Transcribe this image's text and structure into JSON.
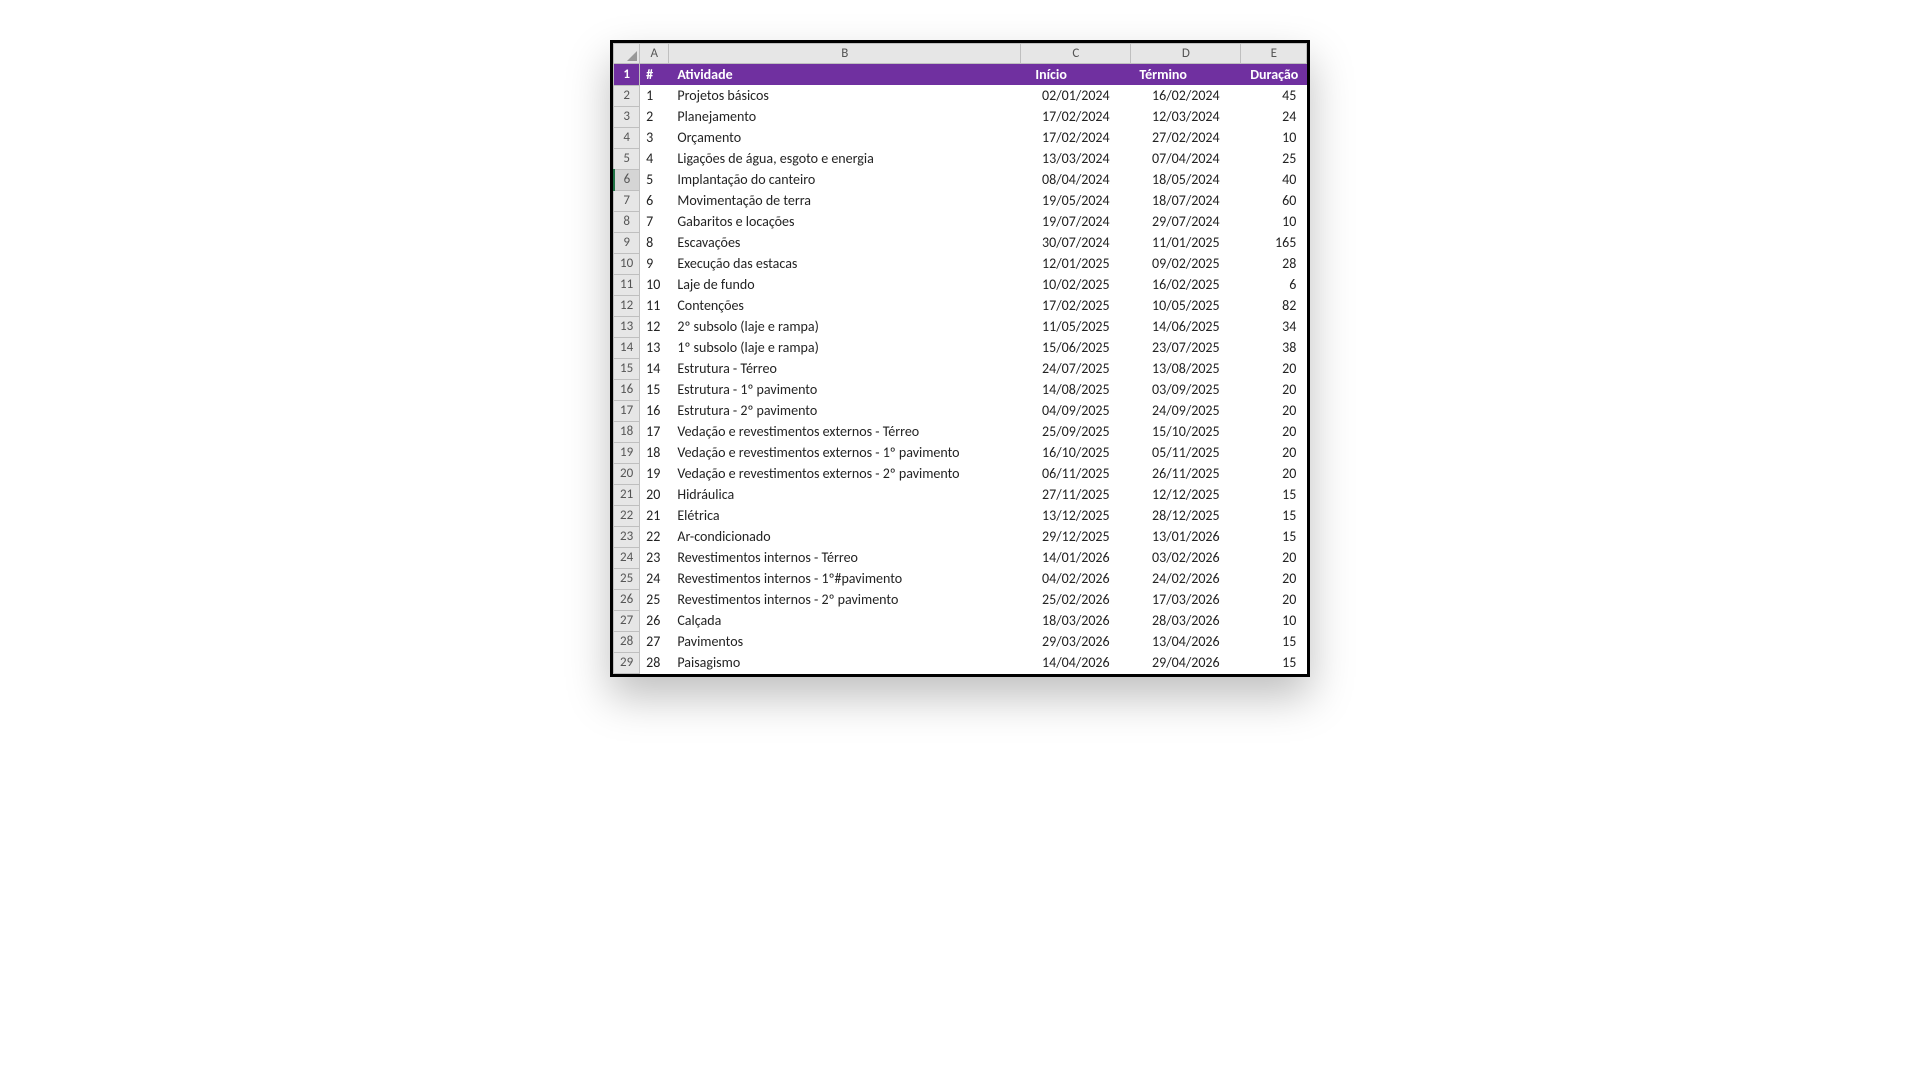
{
  "columns": [
    "A",
    "B",
    "C",
    "D",
    "E"
  ],
  "headers": {
    "num": "#",
    "atividade": "Atividade",
    "inicio": "Início",
    "termino": "Término",
    "duracao": "Duração"
  },
  "rows": [
    {
      "num": "1",
      "atividade": "Projetos básicos",
      "inicio": "02/01/2024",
      "termino": "16/02/2024",
      "duracao": "45"
    },
    {
      "num": "2",
      "atividade": "Planejamento",
      "inicio": "17/02/2024",
      "termino": "12/03/2024",
      "duracao": "24"
    },
    {
      "num": "3",
      "atividade": "Orçamento",
      "inicio": "17/02/2024",
      "termino": "27/02/2024",
      "duracao": "10"
    },
    {
      "num": "4",
      "atividade": "Ligações de água, esgoto e energia",
      "inicio": "13/03/2024",
      "termino": "07/04/2024",
      "duracao": "25"
    },
    {
      "num": "5",
      "atividade": "Implantação do canteiro",
      "inicio": "08/04/2024",
      "termino": "18/05/2024",
      "duracao": "40"
    },
    {
      "num": "6",
      "atividade": "Movimentação de terra",
      "inicio": "19/05/2024",
      "termino": "18/07/2024",
      "duracao": "60"
    },
    {
      "num": "7",
      "atividade": "Gabaritos e locações",
      "inicio": "19/07/2024",
      "termino": "29/07/2024",
      "duracao": "10"
    },
    {
      "num": "8",
      "atividade": "Escavações",
      "inicio": "30/07/2024",
      "termino": "11/01/2025",
      "duracao": "165"
    },
    {
      "num": "9",
      "atividade": "Execução das estacas",
      "inicio": "12/01/2025",
      "termino": "09/02/2025",
      "duracao": "28"
    },
    {
      "num": "10",
      "atividade": "Laje de fundo",
      "inicio": "10/02/2025",
      "termino": "16/02/2025",
      "duracao": "6"
    },
    {
      "num": "11",
      "atividade": "Contenções",
      "inicio": "17/02/2025",
      "termino": "10/05/2025",
      "duracao": "82"
    },
    {
      "num": "12",
      "atividade": "2º subsolo (laje e rampa)",
      "inicio": "11/05/2025",
      "termino": "14/06/2025",
      "duracao": "34"
    },
    {
      "num": "13",
      "atividade": "1º subsolo (laje e rampa)",
      "inicio": "15/06/2025",
      "termino": "23/07/2025",
      "duracao": "38"
    },
    {
      "num": "14",
      "atividade": "Estrutura - Térreo",
      "inicio": "24/07/2025",
      "termino": "13/08/2025",
      "duracao": "20"
    },
    {
      "num": "15",
      "atividade": "Estrutura - 1º pavimento",
      "inicio": "14/08/2025",
      "termino": "03/09/2025",
      "duracao": "20"
    },
    {
      "num": "16",
      "atividade": "Estrutura - 2º pavimento",
      "inicio": "04/09/2025",
      "termino": "24/09/2025",
      "duracao": "20"
    },
    {
      "num": "17",
      "atividade": "Vedação e revestimentos externos - Térreo",
      "inicio": "25/09/2025",
      "termino": "15/10/2025",
      "duracao": "20"
    },
    {
      "num": "18",
      "atividade": "Vedação e revestimentos externos - 1º pavimento",
      "inicio": "16/10/2025",
      "termino": "05/11/2025",
      "duracao": "20"
    },
    {
      "num": "19",
      "atividade": "Vedação e revestimentos externos - 2º pavimento",
      "inicio": "06/11/2025",
      "termino": "26/11/2025",
      "duracao": "20"
    },
    {
      "num": "20",
      "atividade": "Hidráulica",
      "inicio": "27/11/2025",
      "termino": "12/12/2025",
      "duracao": "15"
    },
    {
      "num": "21",
      "atividade": "Elétrica",
      "inicio": "13/12/2025",
      "termino": "28/12/2025",
      "duracao": "15"
    },
    {
      "num": "22",
      "atividade": "Ar-condicionado",
      "inicio": "29/12/2025",
      "termino": "13/01/2026",
      "duracao": "15"
    },
    {
      "num": "23",
      "atividade": "Revestimentos internos - Térreo",
      "inicio": "14/01/2026",
      "termino": "03/02/2026",
      "duracao": "20"
    },
    {
      "num": "24",
      "atividade": "Revestimentos internos - 1º#pavimento",
      "ino": "04/02/2026",
      "inicio": "04/02/2026",
      "termino": "24/02/2026",
      "duracao": "20"
    },
    {
      "num": "25",
      "atividade": "Revestimentos internos - 2º pavimento",
      "inicio": "25/02/2026",
      "termino": "17/03/2026",
      "duracao": "20"
    },
    {
      "num": "26",
      "atividade": "Calçada",
      "inicio": "18/03/2026",
      "termino": "28/03/2026",
      "duracao": "10"
    },
    {
      "num": "27",
      "atividade": "Pavimentos",
      "inicio": "29/03/2026",
      "termino": "13/04/2026",
      "duracao": "15"
    },
    {
      "num": "28",
      "atividade": "Paisagismo",
      "inicio": "14/04/2026",
      "termino": "29/04/2026",
      "duracao": "15"
    }
  ],
  "selected_row_header": 6
}
